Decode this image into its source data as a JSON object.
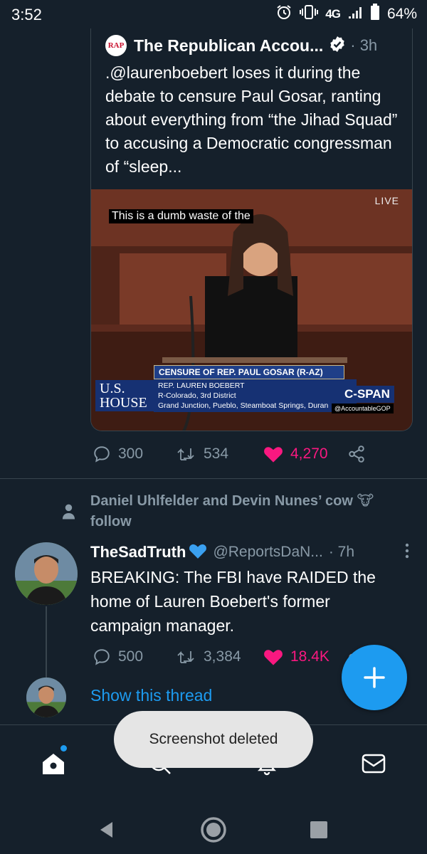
{
  "status_bar": {
    "time": "3:52",
    "network": "4G",
    "battery": "64%",
    "icons": [
      "alarm-icon",
      "vibrate-icon",
      "signal-icon",
      "battery-icon"
    ]
  },
  "quote_tweet": {
    "logo_text": "RAP",
    "author": "The Republican Accou...",
    "time": "· 3h",
    "text": ".@laurenboebert loses it during the debate to censure Paul Gosar, ranting about everything from “the Jihad Squad” to accusing a Democratic congressman of “sleep...",
    "video": {
      "caption": "This is a dumb waste of the",
      "live": "LIVE",
      "lower_third_title": "CENSURE OF REP. PAUL GOSAR (R-AZ)",
      "lower_third_name": "REP. LAUREN BOEBERT",
      "lower_third_district": "R-Colorado, 3rd District",
      "lower_third_towns": "Grand Junction, Pueblo, Steamboat Springs, Duran",
      "house_label_1": "U.S.",
      "house_label_2": "HOUSE",
      "network": "C-SPAN",
      "watermark": "@AccountableGOP"
    },
    "actions": {
      "replies": "300",
      "retweets": "534",
      "likes": "4,270"
    }
  },
  "tweet": {
    "social_context": "Daniel Uhlfelder and Devin Nunes’ cow 🐮 follow",
    "author": "TheSadTruth",
    "handle": "@ReportsDaN...",
    "time": "· 7h",
    "text": "BREAKING: The FBI have RAIDED the home of Lauren Boebert's former campaign manager.",
    "actions": {
      "replies": "500",
      "retweets": "3,384",
      "likes": "18.4K"
    },
    "show_thread": "Show this thread"
  },
  "toast": "Screenshot deleted",
  "colors": {
    "background": "#15202b",
    "accent": "#1d9bf0",
    "like": "#f91880",
    "muted": "#8899a6"
  },
  "bottom_nav": [
    "home-icon",
    "search-icon",
    "notifications-icon",
    "messages-icon"
  ],
  "system_nav": [
    "back-icon",
    "home-circle-icon",
    "recents-icon"
  ]
}
